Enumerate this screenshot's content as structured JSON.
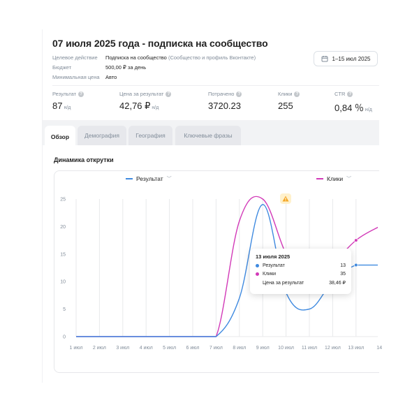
{
  "header": {
    "title": "07 июля 2025 года - подписка на сообщество",
    "rows": [
      {
        "key": "Целевое действие",
        "value": "Подписка на сообщество",
        "note": "(Сообщество и профиль Вконтакте)"
      },
      {
        "key": "Бюджет",
        "value": "500,00 ₽ за день",
        "note": ""
      },
      {
        "key": "Минимальная цена",
        "value": "Авто",
        "note": ""
      }
    ],
    "date_range": "1–15 июл 2025"
  },
  "stats": [
    {
      "label": "Результат",
      "value": "87",
      "unit": "н/д"
    },
    {
      "label": "Цена за результат",
      "value": "42,76 ₽",
      "unit": "н/д"
    },
    {
      "label": "Потрачено",
      "value": "3720.23",
      "unit": ""
    },
    {
      "label": "Клики",
      "value": "255",
      "unit": ""
    },
    {
      "label": "CTR",
      "value": "0,84 ％",
      "unit": "н/д"
    }
  ],
  "tabs": [
    {
      "label": "Обзор"
    },
    {
      "label": "Демография"
    },
    {
      "label": "География"
    },
    {
      "label": "Ключевые фразы"
    }
  ],
  "chart_section": {
    "title": "Динамика открутки",
    "left_selector": "Результат",
    "right_selector": "Клики"
  },
  "colors": {
    "result": "#3f8ae0",
    "clicks": "#d23ab8",
    "accent_warn": "#f5a623"
  },
  "chart_data": {
    "type": "line",
    "x": [
      "1 июл",
      "2 июл",
      "3 июл",
      "4 июл",
      "5 июл",
      "6 июл",
      "7 июл",
      "8 июл",
      "9 июл",
      "10 июл",
      "11 июл",
      "12 июл",
      "13 июл",
      "14"
    ],
    "ylim": [
      0,
      25
    ],
    "y_ticks": [
      "0",
      "5",
      "10",
      "15",
      "20",
      "25"
    ],
    "series": [
      {
        "name": "Результат",
        "color": "#3f8ae0",
        "values": [
          0,
          0,
          0,
          0,
          0,
          0,
          0,
          7,
          24,
          8,
          5,
          10,
          13,
          13
        ]
      },
      {
        "name": "Клики",
        "color": "#d23ab8",
        "values": [
          0,
          0,
          0,
          0,
          0,
          0,
          0,
          21,
          25,
          15,
          8,
          13,
          17.5,
          20
        ]
      }
    ],
    "grid": true
  },
  "tooltip": {
    "date": "13 июля 2025",
    "rows": [
      {
        "label": "Результат",
        "value": "13",
        "color": "#3f8ae0"
      },
      {
        "label": "Клики",
        "value": "35",
        "color": "#d23ab8"
      },
      {
        "label": "Цена за результат",
        "value": "38,46 ₽",
        "color": ""
      }
    ]
  }
}
